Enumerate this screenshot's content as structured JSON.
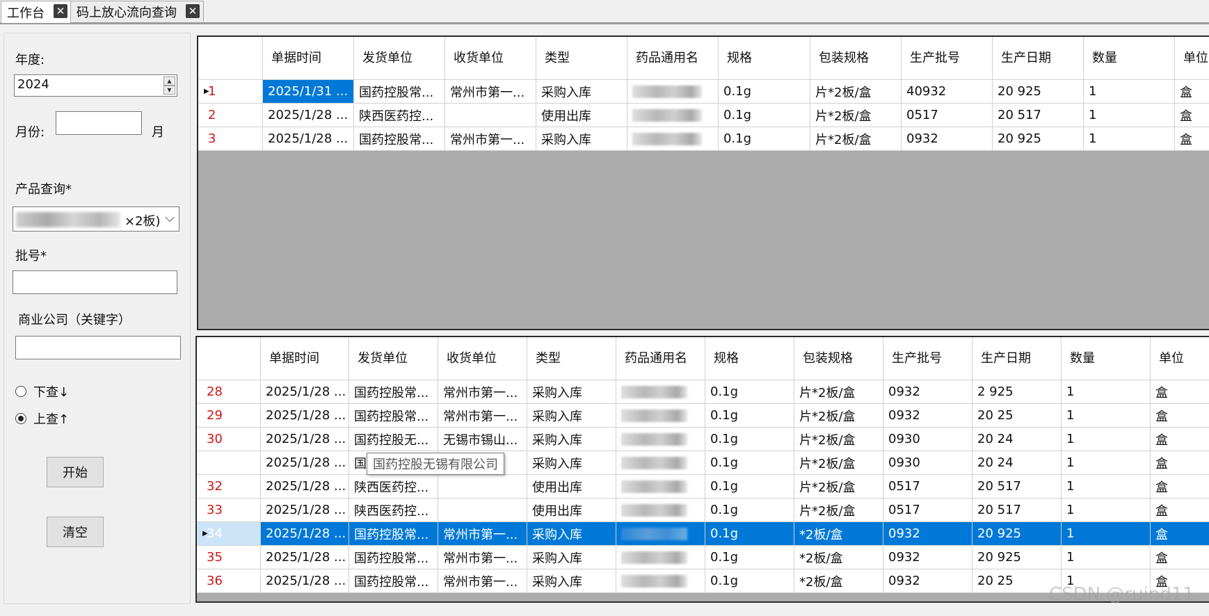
{
  "tabs": [
    {
      "label": "工作台",
      "close": "✕"
    },
    {
      "label": "码上放心流向查询",
      "close": "✕"
    }
  ],
  "filters": {
    "year_label": "年度:",
    "year_value": "2024",
    "month_label": "月份:",
    "month_value": "",
    "month_suffix": "月",
    "product_label": "产品查询*",
    "product_value": "×2板)",
    "batch_label": "批号*",
    "batch_value": "",
    "company_label": "商业公司（关键字）",
    "company_value": "",
    "radio_down": "下查↓",
    "radio_up": "上查↑",
    "radio_selected": "up",
    "start_button": "开始",
    "clear_button": "清空"
  },
  "columns": [
    "单据时间",
    "发货单位",
    "收货单位",
    "类型",
    "药品通用名",
    "规格",
    "包装规格",
    "生产批号",
    "生产日期",
    "数量",
    "单位"
  ],
  "top_grid": {
    "rows": [
      {
        "idx": "1",
        "marker": "▶",
        "time": "2025/1/31 ...",
        "from": "国药控股常...",
        "to": "常州市第一...",
        "type": "采购入库",
        "spec": "0.1g",
        "pack": "片*2板/盒",
        "batch": "40932",
        "date": "20   925",
        "qty": "1",
        "unit": "盒"
      },
      {
        "idx": "2",
        "marker": "",
        "time": "2025/1/28 ...",
        "from": "陕西医药控...",
        "to": "",
        "type": "使用出库",
        "spec": "0.1g",
        "pack": "片*2板/盒",
        "batch": "0517",
        "date": "20   517",
        "qty": "1",
        "unit": "盒"
      },
      {
        "idx": "3",
        "marker": "",
        "time": "2025/1/28 ...",
        "from": "国药控股常...",
        "to": "常州市第一...",
        "type": "采购入库",
        "spec": "0.1g",
        "pack": "片*2板/盒",
        "batch": "0932",
        "date": "20   925",
        "qty": "1",
        "unit": "盒"
      }
    ]
  },
  "bottom_grid": {
    "rows": [
      {
        "idx": "28",
        "marker": "",
        "time": "2025/1/28 ...",
        "from": "国药控股常...",
        "to": "常州市第一...",
        "type": "采购入库",
        "spec": "0.1g",
        "pack": "片*2板/盒",
        "batch": "0932",
        "date": "2   925",
        "qty": "1",
        "unit": "盒"
      },
      {
        "idx": "29",
        "marker": "",
        "time": "2025/1/28 ...",
        "from": "国药控股常...",
        "to": "常州市第一...",
        "type": "采购入库",
        "spec": "0.1g",
        "pack": "片*2板/盒",
        "batch": "0932",
        "date": "20   25",
        "qty": "1",
        "unit": "盒"
      },
      {
        "idx": "30",
        "marker": "",
        "time": "2025/1/28 ...",
        "from": "国药控股无...",
        "to": "无锡市锡山...",
        "type": "采购入库",
        "spec": "0.1g",
        "pack": "片*2板/盒",
        "batch": "0930",
        "date": "20   24",
        "qty": "1",
        "unit": "盒"
      },
      {
        "idx": "",
        "marker": "",
        "time": "2025/1/28 ...",
        "from": "国",
        "to": "",
        "type": "采购入库",
        "spec": "0.1g",
        "pack": "片*2板/盒",
        "batch": "0930",
        "date": "20   24",
        "qty": "1",
        "unit": "盒"
      },
      {
        "idx": "32",
        "marker": "",
        "time": "2025/1/28 ...",
        "from": "陕西医药控...",
        "to": "",
        "type": "使用出库",
        "spec": "0.1g",
        "pack": "片*2板/盒",
        "batch": "0517",
        "date": "20   517",
        "qty": "1",
        "unit": "盒"
      },
      {
        "idx": "33",
        "marker": "",
        "time": "2025/1/28 ...",
        "from": "陕西医药控...",
        "to": "",
        "type": "使用出库",
        "spec": "0.1g",
        "pack": "片*2板/盒",
        "batch": "0517",
        "date": "20   517",
        "qty": "1",
        "unit": "盒"
      },
      {
        "idx": "34",
        "marker": "▶",
        "time": "2025/1/28 ...",
        "from": "国药控股常...",
        "to": "常州市第一...",
        "type": "采购入库",
        "spec": "0.1g",
        "pack": "*2板/盒",
        "batch": "0932",
        "date": "20   925",
        "qty": "1",
        "unit": "盒"
      },
      {
        "idx": "35",
        "marker": "",
        "time": "2025/1/28 ...",
        "from": "国药控股常...",
        "to": "常州市第一...",
        "type": "采购入库",
        "spec": "0.1g",
        "pack": "*2板/盒",
        "batch": "0932",
        "date": "20   925",
        "qty": "1",
        "unit": "盒"
      },
      {
        "idx": "36",
        "marker": "",
        "time": "2025/1/28 ...",
        "from": "国药控股常...",
        "to": "常州市第一...",
        "type": "采购入库",
        "spec": "0.1g",
        "pack": "*2板/盒",
        "batch": "0932",
        "date": "20   25",
        "qty": "1",
        "unit": "盒"
      }
    ],
    "selected_index": 6
  },
  "tooltip": "国药控股无锡有限公司",
  "watermark": "CSDN @ruind11"
}
